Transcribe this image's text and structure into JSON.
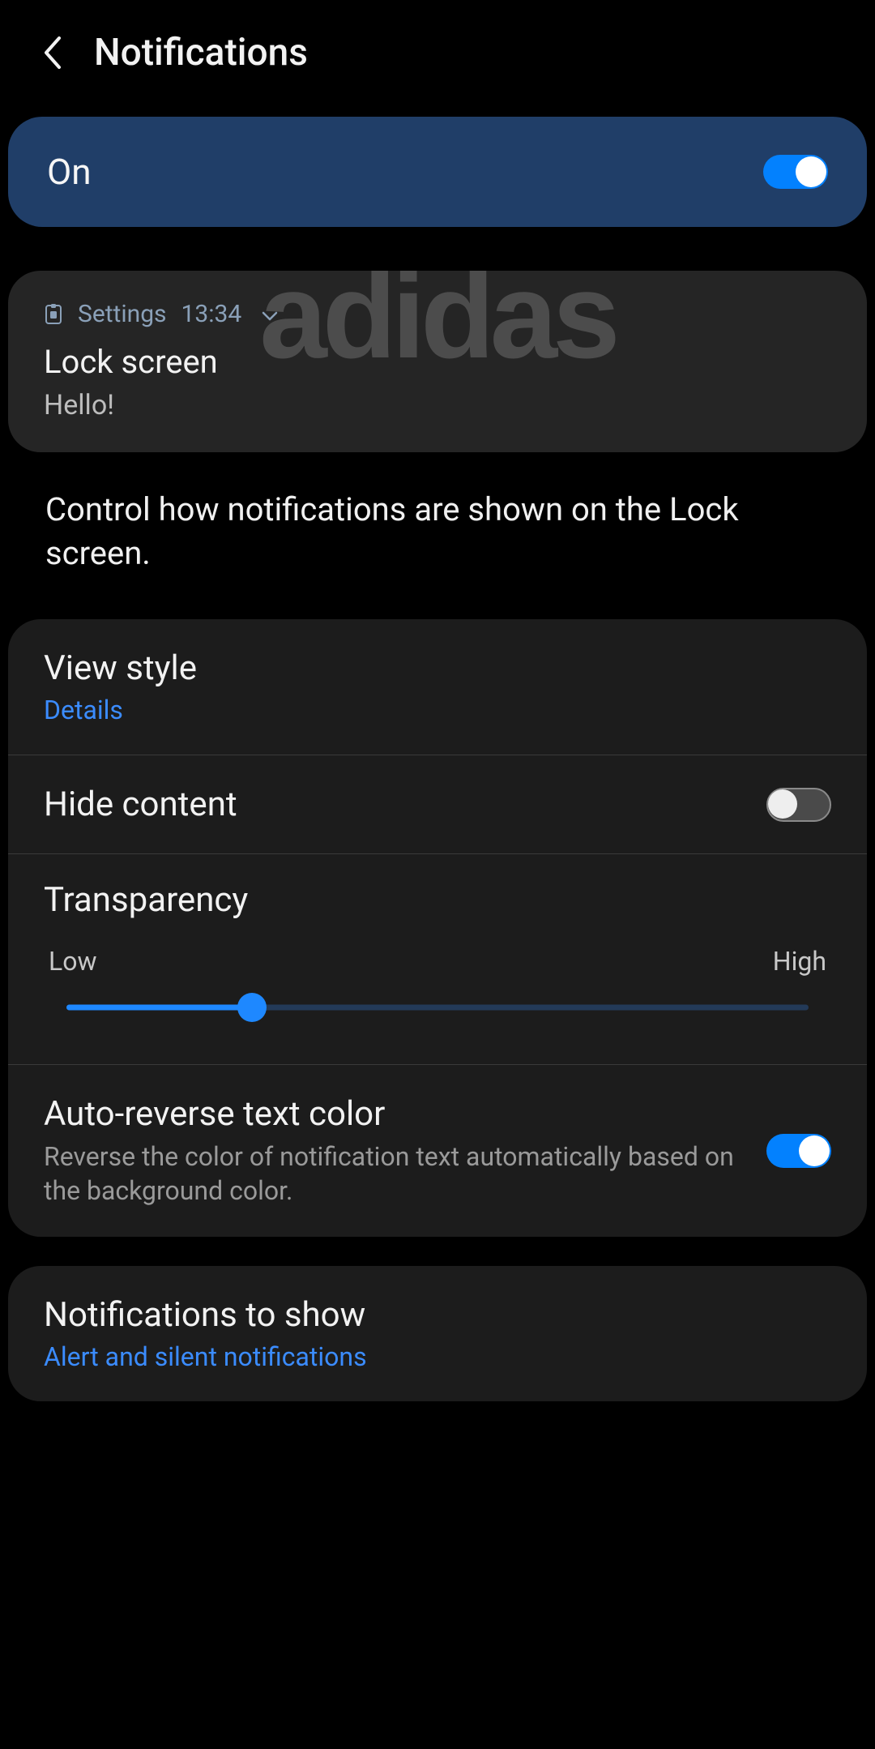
{
  "header": {
    "title": "Notifications"
  },
  "master": {
    "label": "On",
    "enabled": true
  },
  "preview": {
    "watermark": "adidas",
    "app": "Settings",
    "time": "13:34",
    "title": "Lock screen",
    "body": "Hello!"
  },
  "description": "Control how notifications are shown on the Lock screen.",
  "settings": {
    "view_style": {
      "title": "View style",
      "value": "Details"
    },
    "hide_content": {
      "title": "Hide content",
      "enabled": false
    },
    "transparency": {
      "title": "Transparency",
      "low": "Low",
      "high": "High",
      "percent": 25
    },
    "auto_reverse": {
      "title": "Auto-reverse text color",
      "desc": "Reverse the color of notification text automatically based on the background color.",
      "enabled": true
    },
    "notifications_to_show": {
      "title": "Notifications to show",
      "value": "Alert and silent notifications"
    }
  },
  "colors": {
    "accent": "#1e88ff"
  }
}
